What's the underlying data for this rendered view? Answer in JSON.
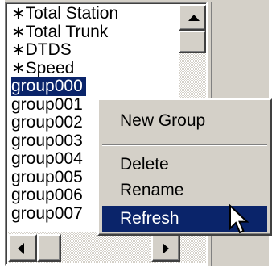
{
  "list": {
    "items": [
      "∗Total Station",
      "∗Total Trunk",
      "∗DTDS",
      "∗Speed",
      "group000",
      "group001",
      "group002",
      "group003",
      "group004",
      "group005",
      "group006",
      "group007"
    ],
    "selected_item": "group000"
  },
  "context_menu": {
    "new_group": "New Group",
    "delete": "Delete",
    "rename": "Rename",
    "refresh": "Refresh",
    "highlighted_item": "Refresh"
  },
  "icons": {
    "scroll_up": "arrow-up-icon",
    "scroll_left": "arrow-left-icon",
    "scroll_right": "arrow-right-icon",
    "cursor": "mouse-pointer-icon"
  },
  "colors": {
    "selection": "#0a246a",
    "face": "#d4d0c8"
  }
}
